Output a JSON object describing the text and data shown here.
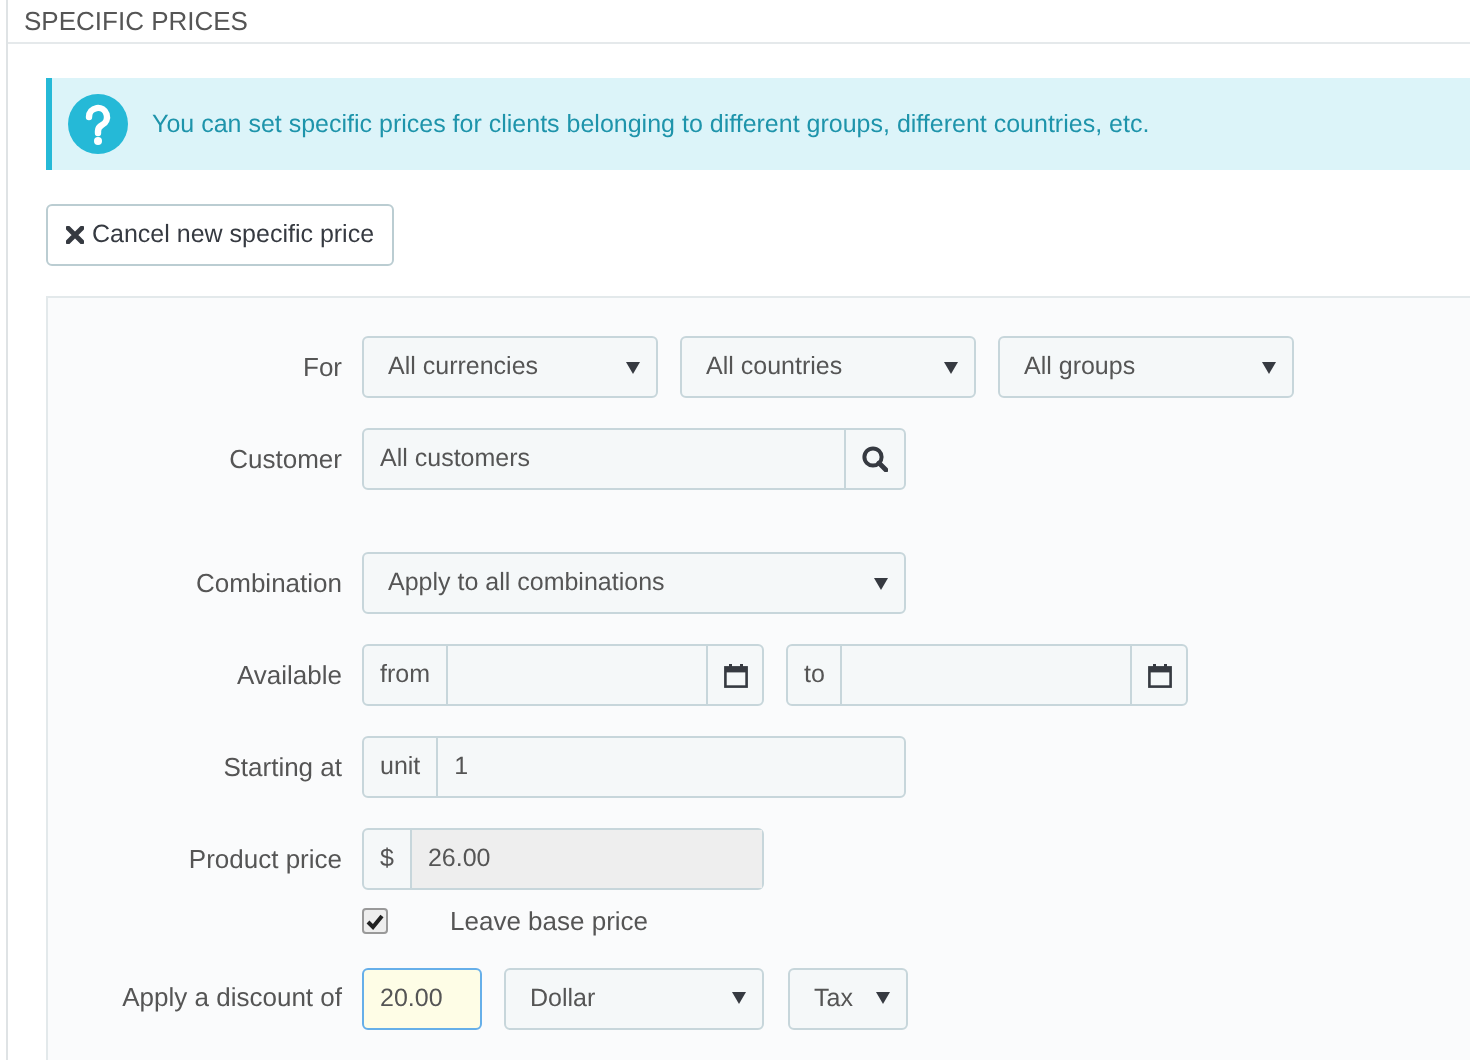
{
  "section_title": "SPECIFIC PRICES",
  "alert": {
    "text": "You can set specific prices for clients belonging to different groups, different countries, etc."
  },
  "cancel_button": {
    "label": "Cancel new specific price"
  },
  "form": {
    "rows": [
      {
        "kind": "selects",
        "label": "For",
        "selects": [
          {
            "value": "All currencies"
          },
          {
            "value": "All countries"
          },
          {
            "value": "All groups"
          }
        ]
      },
      {
        "kind": "search",
        "label": "Customer",
        "value": "All customers"
      },
      {
        "kind": "selects",
        "label": "Combination",
        "selects": [
          {
            "value": "Apply to all combinations"
          }
        ]
      },
      {
        "kind": "dates",
        "label": "Available",
        "ranges": [
          {
            "prefix": "from"
          },
          {
            "prefix": "to"
          }
        ]
      },
      {
        "kind": "prefixed",
        "label": "Starting at",
        "prefix": "unit",
        "value": "1",
        "disabled": false
      },
      {
        "kind": "prefixed",
        "label": "Product price",
        "prefix": "$",
        "value": "26.00",
        "disabled": true
      },
      {
        "kind": "checkbox",
        "label": "Leave base price",
        "checked": true
      },
      {
        "kind": "discount",
        "label": "Apply a discount of",
        "value": "20.00",
        "focused": true,
        "selects": [
          {
            "value": "Dollar"
          },
          {
            "value": "Tax"
          }
        ]
      }
    ]
  }
}
